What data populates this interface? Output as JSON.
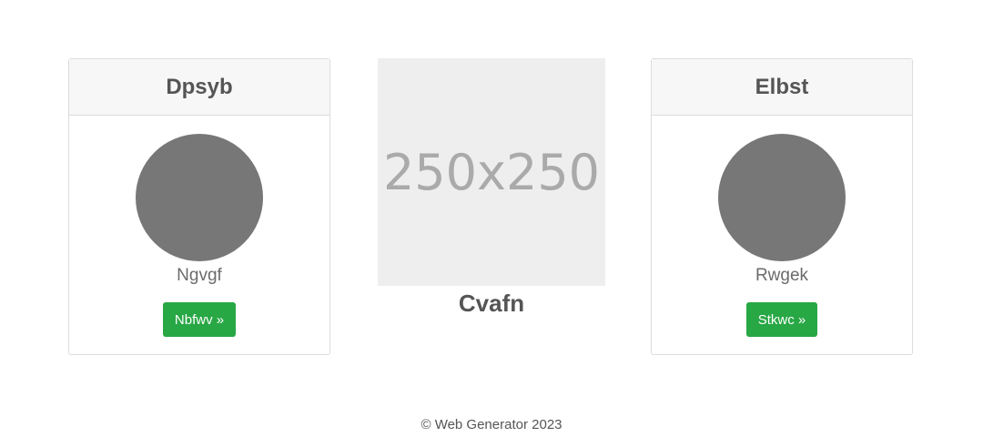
{
  "cards": [
    {
      "title": "Dpsyb",
      "name": "Ngvgf",
      "button_label": "Nbfwv »"
    },
    {
      "title": "Elbst",
      "name": "Rwgek",
      "button_label": "Stkwc »"
    }
  ],
  "center": {
    "image_text": "250x250",
    "title": "Cvafn"
  },
  "footer": {
    "text": "© Web Generator 2023"
  },
  "colors": {
    "button": "#28a745",
    "avatar": "#777777",
    "placeholder_bg": "#eeeeee"
  }
}
